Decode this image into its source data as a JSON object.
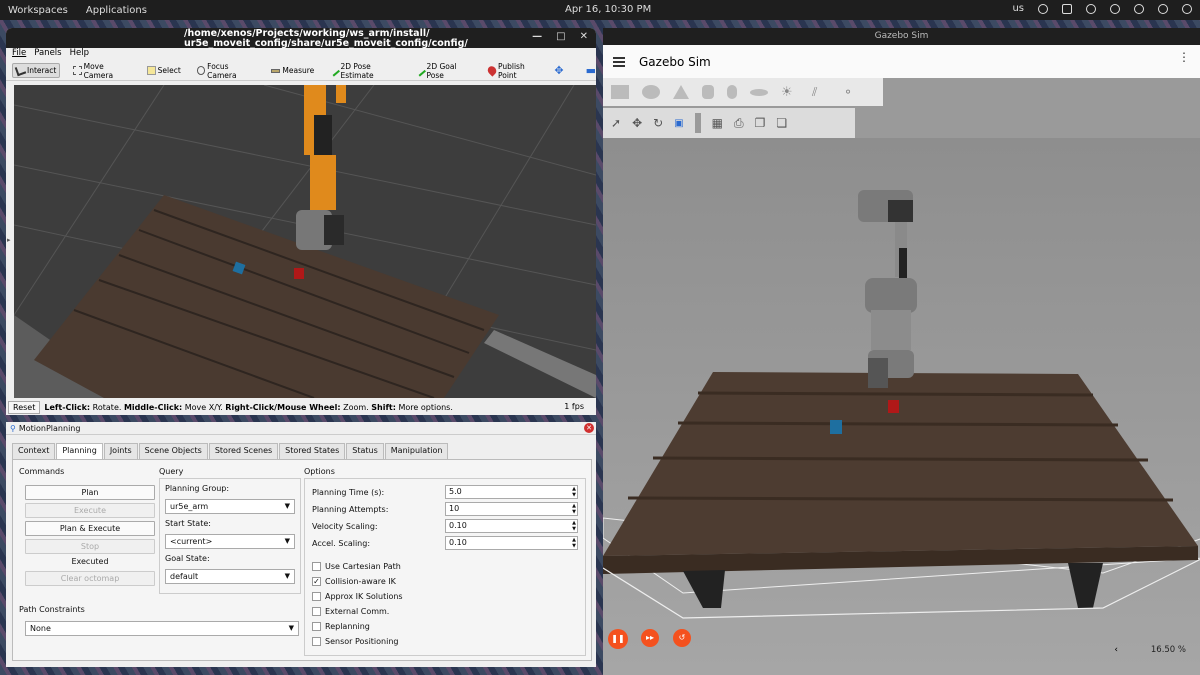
{
  "topbar": {
    "workspaces": "Workspaces",
    "applications": "Applications",
    "clock": "Apr 16, 10:30 PM",
    "keyboard": "us"
  },
  "rviz": {
    "title_line1": "/home/xenos/Projects/working/ws_arm/install/",
    "title_line2": "ur5e_moveit_config/share/ur5e_moveit_config/config/",
    "menu": [
      "File",
      "Panels",
      "Help"
    ],
    "tools": [
      {
        "label": "Interact",
        "icon": "cursor-icon"
      },
      {
        "label": "Move Camera",
        "icon": "move-camera-icon"
      },
      {
        "label": "Select",
        "icon": "select-icon"
      },
      {
        "label": "Focus Camera",
        "icon": "focus-camera-icon"
      },
      {
        "label": "Measure",
        "icon": "ruler-icon"
      },
      {
        "label": "2D Pose Estimate",
        "icon": "pose-estimate-icon"
      },
      {
        "label": "2D Goal Pose",
        "icon": "goal-pose-icon"
      },
      {
        "label": "Publish Point",
        "icon": "publish-point-icon"
      }
    ],
    "status": {
      "reset": "Reset",
      "left": "Left-Click:",
      "left_t": " Rotate. ",
      "mid": "Middle-Click:",
      "mid_t": " Move X/Y. ",
      "right": "Right-Click/Mouse Wheel:",
      "right_t": " Zoom. ",
      "shift": "Shift:",
      "shift_t": " More options.",
      "fps": "1 fps"
    }
  },
  "motion": {
    "title": "MotionPlanning",
    "tabs": [
      "Context",
      "Planning",
      "Joints",
      "Scene Objects",
      "Stored Scenes",
      "Stored States",
      "Status",
      "Manipulation"
    ],
    "commands": {
      "header": "Commands",
      "plan": "Plan",
      "execute": "Execute",
      "plan_execute": "Plan & Execute",
      "stop": "Stop",
      "result": "Executed",
      "clear": "Clear octomap"
    },
    "query": {
      "header": "Query",
      "group_label": "Planning Group:",
      "group": "ur5e_arm",
      "start_label": "Start State:",
      "start": "<current>",
      "goal_label": "Goal State:",
      "goal": "default"
    },
    "options": {
      "header": "Options",
      "planning_time_label": "Planning Time (s):",
      "planning_time": "5.0",
      "attempts_label": "Planning Attempts:",
      "attempts": "10",
      "velocity_label": "Velocity Scaling:",
      "velocity": "0.10",
      "accel_label": "Accel. Scaling:",
      "accel": "0.10",
      "checks": [
        {
          "label": "Use Cartesian Path",
          "checked": false
        },
        {
          "label": "Collision-aware IK",
          "checked": true
        },
        {
          "label": "Approx IK Solutions",
          "checked": false
        },
        {
          "label": "External Comm.",
          "checked": false
        },
        {
          "label": "Replanning",
          "checked": false
        },
        {
          "label": "Sensor Positioning",
          "checked": false
        }
      ]
    },
    "path": {
      "header": "Path Constraints",
      "value": "None"
    }
  },
  "gazebo": {
    "window_title": "Gazebo Sim",
    "app_title": "Gazebo Sim",
    "zoom": "16.50 %"
  }
}
